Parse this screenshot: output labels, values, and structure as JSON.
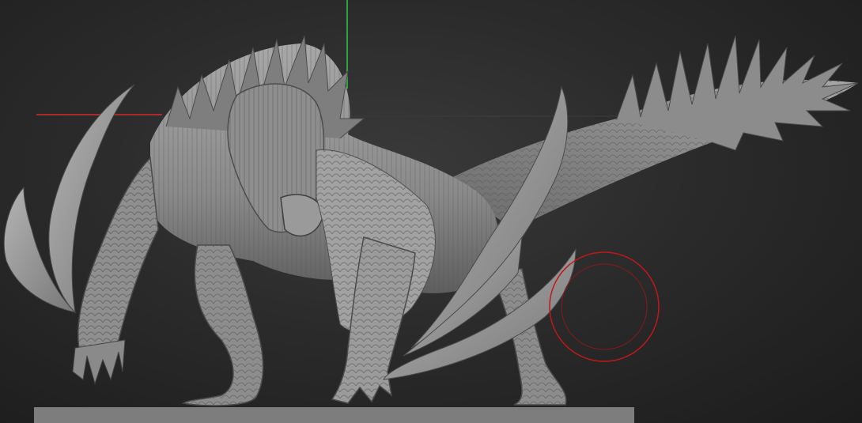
{
  "viewport": {
    "description_free": true,
    "background_color": "#2b2b2b"
  },
  "colors": {
    "x_axis": "#d22a2a",
    "y_axis": "#2ecc40",
    "brush": "#c01818",
    "model_base": "#9a9a9a",
    "model_shadow": "#3d3d3d",
    "floor": "#7d7d7d"
  },
  "icons": {
    "brush_cursor": "circle-brush-icon"
  }
}
